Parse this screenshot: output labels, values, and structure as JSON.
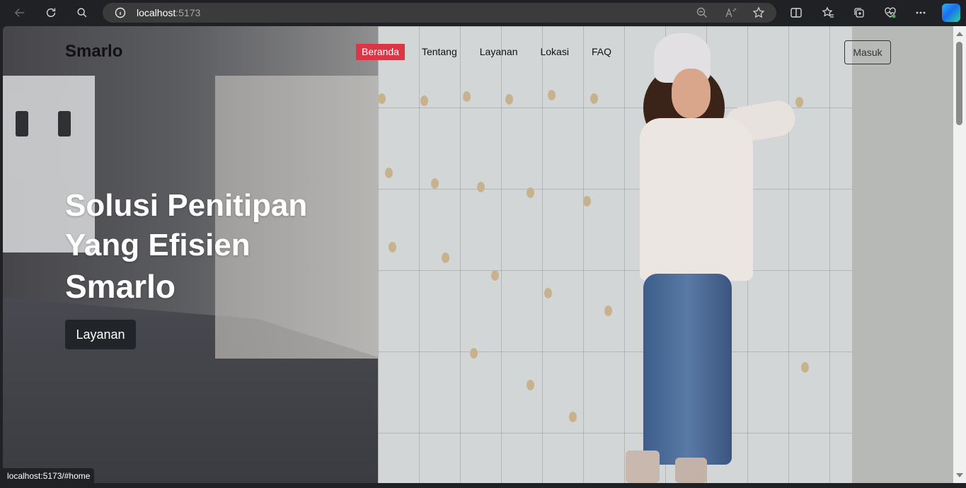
{
  "browser": {
    "url_host": "localhost",
    "url_port": ":5173",
    "status_url": "localhost:5173/#home"
  },
  "site": {
    "brand": "Smarlo",
    "nav": [
      {
        "label": "Beranda",
        "active": true
      },
      {
        "label": "Tentang",
        "active": false
      },
      {
        "label": "Layanan",
        "active": false
      },
      {
        "label": "Lokasi",
        "active": false
      },
      {
        "label": "FAQ",
        "active": false
      }
    ],
    "login_label": "Masuk"
  },
  "hero": {
    "line1": "Solusi Penitipan",
    "line2": "Yang Efisien",
    "line3": "Smarlo",
    "cta_label": "Layanan"
  },
  "colors": {
    "active_nav": "#dc3545",
    "cta_bg": "#212529",
    "browser_bg": "#202124"
  },
  "icons": [
    "back-icon",
    "refresh-icon",
    "search-icon",
    "info-icon",
    "zoom-out-icon",
    "read-aloud-icon",
    "favorite-star-icon",
    "split-screen-icon",
    "favorites-icon",
    "collections-icon",
    "health-icon",
    "more-icon",
    "copilot-icon"
  ]
}
